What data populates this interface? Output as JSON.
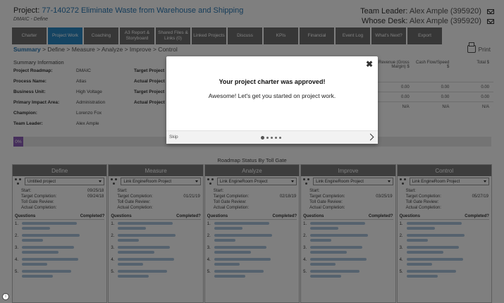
{
  "header": {
    "project_label": "Project:",
    "project_link": "77-140272 Eliminate Waste from Warehouse and Shipping",
    "subtitle": "DMAIC - Define",
    "team_leader_label": "Team Leader:",
    "team_leader_name": "Alex Ample (395920)",
    "whose_desk_label": "Whose Desk:",
    "whose_desk_name": "Alex Ample (395920)"
  },
  "tabs": [
    {
      "label": "Charter",
      "active": false
    },
    {
      "label": "Project Work",
      "active": true
    },
    {
      "label": "Coaching",
      "active": false
    },
    {
      "label": "A3 Report & Storyboard",
      "active": false
    },
    {
      "label": "Shared Files & Links (0)",
      "active": false
    },
    {
      "label": "Linked Projects",
      "active": false
    },
    {
      "label": "Discuss",
      "active": false
    },
    {
      "label": "KPIs",
      "active": false
    },
    {
      "label": "Financial",
      "active": false
    },
    {
      "label": "Event Log",
      "active": false
    },
    {
      "label": "What's Next?",
      "active": false
    },
    {
      "label": "Export",
      "active": false
    }
  ],
  "breadcrumb": {
    "current": "Summary",
    "rest": " > Define > Measure > Analyze > Improve > Control"
  },
  "print_label": "Print",
  "summary": {
    "title": "Summary Information",
    "rows": [
      {
        "k": "Project Roadmap:",
        "v": "DMAIC",
        "k2": "Target Project"
      },
      {
        "k": "Process Name:",
        "v": "Atlas",
        "k2": "Actual Project"
      },
      {
        "k": "Business Unit:",
        "v": "High Voltage",
        "k2": "Target Project"
      },
      {
        "k": "Primary Impact Area:",
        "v": "Administration",
        "k2": "Actual Project"
      },
      {
        "k": "Champion:",
        "v": "Lorenzo Fox",
        "k2": ""
      },
      {
        "k": "Team Leader:",
        "v": "Alex Ample",
        "k2": ""
      }
    ]
  },
  "financials": {
    "headers": [
      "Revenue (Gross Margin) $",
      "Cash Flow/Speed $",
      "Total $"
    ],
    "rows": [
      [
        "0.00",
        "0.00",
        "0.00"
      ],
      [
        "0.00",
        "0.00",
        "0.00"
      ],
      [
        "N/A",
        "N/A",
        "N/A"
      ]
    ]
  },
  "progress": {
    "label": "0%",
    "value": 0
  },
  "roadmap_title": "Roadmap Status By Toll Gate",
  "gates": [
    {
      "name": "Define",
      "select": "Untitled project",
      "start": "09/25/18",
      "target": "09/24/18"
    },
    {
      "name": "Measure",
      "select": "Link EngineRoom Project",
      "start": "",
      "target": "01/21/19"
    },
    {
      "name": "Analyze",
      "select": "Link EngineRoom Project",
      "start": "",
      "target": "02/18/19"
    },
    {
      "name": "Improve",
      "select": "Link EngineRoom Project",
      "start": "",
      "target": "03/25/19"
    },
    {
      "name": "Control",
      "select": "Link EngineRoom Project",
      "start": "",
      "target": "05/27/19"
    }
  ],
  "gate_labels": {
    "start": "Start:",
    "target": "Target Completion:",
    "review": "Toll Gate Review:",
    "actual": "Actual Completion:",
    "questions": "Questions",
    "completed": "Completed?",
    "q1": "1.",
    "q2": "2.",
    "q3": "3.",
    "q4": "4.",
    "q5": "5."
  },
  "modal": {
    "close": "✖",
    "title": "Your project charter was approved!",
    "message": "Awesome! Let's get you started on project work.",
    "skip": "Skip",
    "pages": 5,
    "current_page": 1
  },
  "help_icon": "i"
}
